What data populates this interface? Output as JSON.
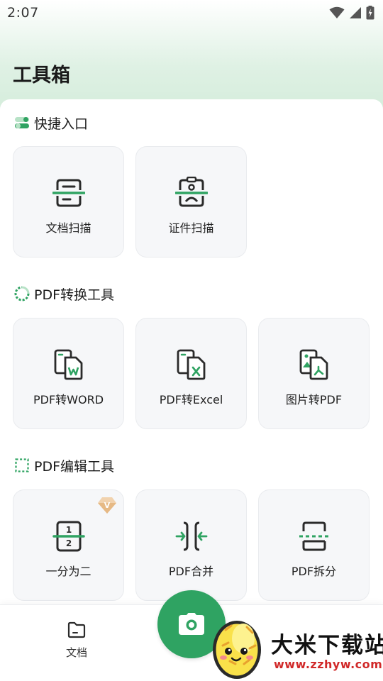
{
  "status_bar": {
    "time": "2:07"
  },
  "header": {
    "title": "工具箱"
  },
  "colors": {
    "accent": "#2fa362",
    "tile_bg": "#f6f7f9",
    "header_gradient": "#d3ecda"
  },
  "sections": [
    {
      "title": "快捷入口",
      "icon": "toggle-icon",
      "tools": [
        {
          "label": "文档扫描",
          "icon": "document-scan-icon"
        },
        {
          "label": "证件扫描",
          "icon": "id-card-scan-icon"
        }
      ]
    },
    {
      "title": "PDF转换工具",
      "icon": "convert-circle-icon",
      "tools": [
        {
          "label": "PDF转WORD",
          "icon": "pdf-to-word-icon"
        },
        {
          "label": "PDF转Excel",
          "icon": "pdf-to-excel-icon"
        },
        {
          "label": "图片转PDF",
          "icon": "image-to-pdf-icon"
        }
      ]
    },
    {
      "title": "PDF编辑工具",
      "icon": "edit-frame-icon",
      "tools": [
        {
          "label": "一分为二",
          "icon": "split-in-two-icon",
          "badge": "V"
        },
        {
          "label": "PDF合并",
          "icon": "pdf-merge-icon"
        },
        {
          "label": "PDF拆分",
          "icon": "pdf-split-icon"
        }
      ]
    }
  ],
  "bottom_nav": {
    "docs_label": "文档",
    "docs_icon": "folder-icon",
    "fab_icon": "camera-icon"
  },
  "watermark": {
    "title": "大米下载站",
    "url": "www.zzhyw.com"
  }
}
